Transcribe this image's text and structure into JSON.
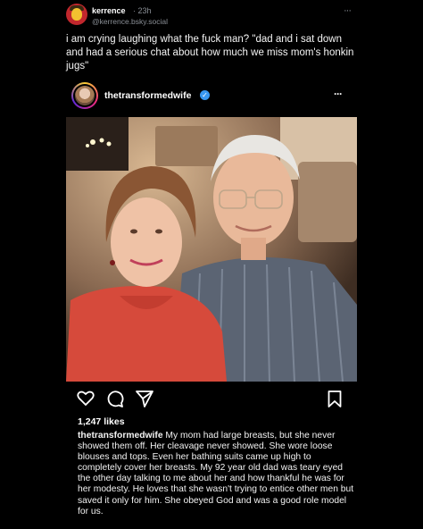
{
  "outer_post": {
    "author_name": "kerrence",
    "time": "· 23h",
    "handle": "@kerrence.bsky.social",
    "more": "···",
    "text": "i am crying laughing what the fuck man? \"dad and i sat down and had a serious chat about how much we miss mom's honkin jugs\""
  },
  "embed": {
    "username": "thetransformedwife",
    "verified_glyph": "✓",
    "more": "···",
    "likes": "1,247 likes",
    "caption_user": "thetransformedwife",
    "caption_text": " My mom had large breasts, but she never showed them off. Her cleavage never showed. She wore loose blouses and tops. Even her bathing suits came up high to completely cover her breasts. My 92 year old dad was teary eyed the other day talking to me about her and how thankful he was for her modesty. He loves that she wasn't trying to entice other men but saved it only for him. She obeyed God and was a good role model for us.",
    "icons": [
      "heart-icon",
      "comment-icon",
      "share-icon",
      "bookmark-icon"
    ]
  }
}
